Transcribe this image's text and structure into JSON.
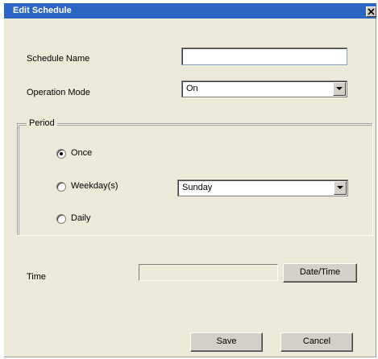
{
  "dialog": {
    "title": "Edit Schedule",
    "close_label": "×"
  },
  "form": {
    "schedule_name": {
      "label": "Schedule Name",
      "value": "",
      "placeholder": ""
    },
    "operation_mode": {
      "label": "Operation Mode",
      "selected": "On"
    }
  },
  "period": {
    "legend": "Period",
    "options": [
      {
        "label": "Once",
        "checked": true
      },
      {
        "label": "Weekday(s)",
        "checked": false
      },
      {
        "label": "Daily",
        "checked": false
      }
    ],
    "weekday_select": {
      "selected": "Sunday"
    }
  },
  "time": {
    "label": "Time",
    "value": "",
    "datetime_button": "Date/Time"
  },
  "actions": {
    "save_label": "Save",
    "cancel_label": "Cancel"
  },
  "colors": {
    "titlebar": "#2b66c6",
    "face": "#ece9d8"
  }
}
